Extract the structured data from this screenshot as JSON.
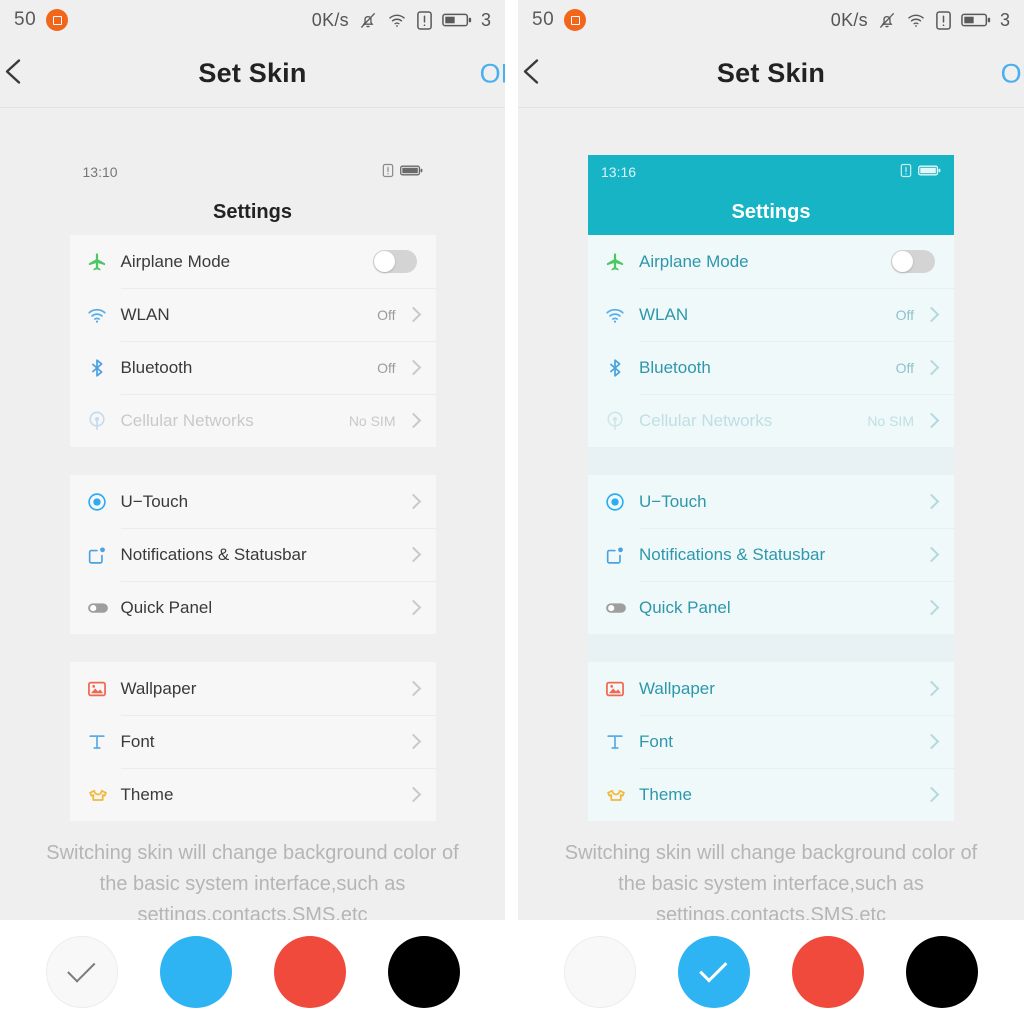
{
  "system_status_bar": {
    "clock_partial": "50",
    "app_icon": "app-square-icon",
    "network_speed": "0K/s",
    "icons": [
      "bell-muted-icon",
      "wifi-icon",
      "sim-alert-icon",
      "battery-icon"
    ],
    "battery_partial": "3"
  },
  "titlebar": {
    "back_icon": "back-chevron-icon",
    "title": "Set Skin",
    "confirm_label": "OK"
  },
  "hint": "Switching skin will change background color of the basic system interface,such as settings,contacts,SMS,etc",
  "swatches": [
    {
      "name": "white",
      "color": "#f8f8f8",
      "selected_left": true,
      "selected_right": false
    },
    {
      "name": "blue",
      "color": "#2eb4f2",
      "selected_left": false,
      "selected_right": true
    },
    {
      "name": "red",
      "color": "#f04a3c",
      "selected_left": false,
      "selected_right": false
    },
    {
      "name": "black",
      "color": "#000000",
      "selected_left": false,
      "selected_right": false
    }
  ],
  "preview_left": {
    "theme": "default",
    "accent": "#efefef",
    "clock": "13:10",
    "status_icons": [
      "sim-alert-icon",
      "battery-icon"
    ],
    "header_title": "Settings"
  },
  "preview_right": {
    "theme": "teal",
    "accent": "#17b4c6",
    "clock": "13:16",
    "status_icons": [
      "sim-alert-icon",
      "battery-icon"
    ],
    "header_title": "Settings"
  },
  "settings_groups": [
    {
      "rows": [
        {
          "icon": "airplane-icon",
          "icon_color": "#4cc764",
          "label": "Airplane Mode",
          "value": "",
          "control": "toggle",
          "toggle_on": false,
          "dimmed": false
        },
        {
          "icon": "wifi-icon",
          "icon_color": "#5bade8",
          "label": "WLAN",
          "value": "Off",
          "control": "chevron",
          "toggle_on": false,
          "dimmed": false
        },
        {
          "icon": "bluetooth-icon",
          "icon_color": "#4aa3e0",
          "label": "Bluetooth",
          "value": "Off",
          "control": "chevron",
          "toggle_on": false,
          "dimmed": false
        },
        {
          "icon": "cellular-icon",
          "icon_color": "#8fc4ea",
          "label": "Cellular Networks",
          "value": "No SIM",
          "control": "chevron",
          "toggle_on": false,
          "dimmed": true
        }
      ]
    },
    {
      "rows": [
        {
          "icon": "utouch-icon",
          "icon_color": "#2eacf0",
          "label": "U−Touch",
          "value": "",
          "control": "chevron",
          "toggle_on": false,
          "dimmed": false
        },
        {
          "icon": "notifications-icon",
          "icon_color": "#4aa3e0",
          "label": "Notifications & Statusbar",
          "value": "",
          "control": "chevron",
          "toggle_on": false,
          "dimmed": false
        },
        {
          "icon": "quickpanel-icon",
          "icon_color": "#9e9e9e",
          "label": "Quick Panel",
          "value": "",
          "control": "chevron",
          "toggle_on": false,
          "dimmed": false
        }
      ]
    },
    {
      "rows": [
        {
          "icon": "wallpaper-icon",
          "icon_color": "#f2674f",
          "label": "Wallpaper",
          "value": "",
          "control": "chevron",
          "toggle_on": false,
          "dimmed": false
        },
        {
          "icon": "font-icon",
          "icon_color": "#5bade8",
          "label": "Font",
          "value": "",
          "control": "chevron",
          "toggle_on": false,
          "dimmed": false
        },
        {
          "icon": "theme-icon",
          "icon_color": "#f0b93c",
          "label": "Theme",
          "value": "",
          "control": "chevron",
          "toggle_on": false,
          "dimmed": false
        }
      ]
    }
  ]
}
